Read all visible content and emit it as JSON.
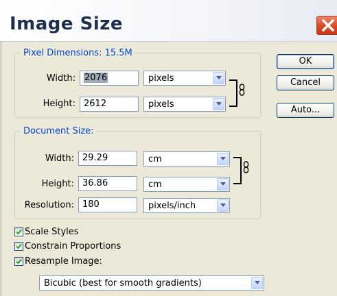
{
  "dialog": {
    "title": "Image Size"
  },
  "pixel_dimensions": {
    "legend": "Pixel Dimensions:  15.5M",
    "width_label": "Width:",
    "width_value": "2076",
    "width_unit": "pixels",
    "height_label": "Height:",
    "height_value": "2612",
    "height_unit": "pixels"
  },
  "document_size": {
    "legend": "Document Size:",
    "width_label": "Width:",
    "width_value": "29.29",
    "width_unit": "cm",
    "height_label": "Height:",
    "height_value": "36.86",
    "height_unit": "cm",
    "resolution_label": "Resolution:",
    "resolution_value": "180",
    "resolution_unit": "pixels/inch"
  },
  "buttons": {
    "ok": "OK",
    "cancel": "Cancel",
    "auto": "Auto..."
  },
  "options": {
    "scale_styles": {
      "label": "Scale Styles",
      "checked": true
    },
    "constrain_proportions": {
      "label": "Constrain Proportions",
      "checked": true
    },
    "resample_image": {
      "label": "Resample Image:",
      "checked": true
    },
    "resample_method": "Bicubic (best for smooth gradients)"
  },
  "icons": {
    "close": "close-icon",
    "dropdown": "chevron-down-icon",
    "link": "chain-link-icon",
    "check": "checkmark-icon"
  },
  "colors": {
    "window_bg": "#ece9d8",
    "legend_text": "#0046d5",
    "close_button": "#d84a26",
    "title_text": "#1d2f4d"
  }
}
